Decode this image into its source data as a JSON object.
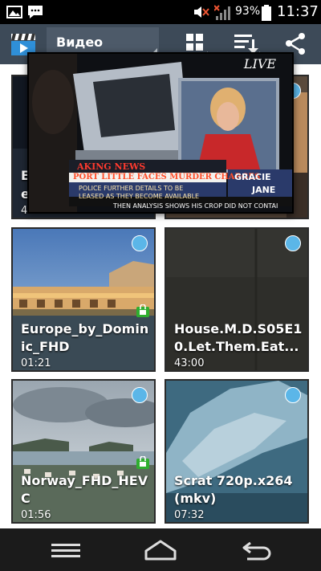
{
  "status_bar": {
    "icons_left": [
      "image-icon",
      "message-icon"
    ],
    "icons_right": [
      "mute-icon",
      "signal-icon",
      "battery-icon"
    ],
    "battery_percent": "93%",
    "time": "11:37"
  },
  "action_bar": {
    "title": "Видео",
    "buttons": [
      "grid-view-icon",
      "sort-icon",
      "share-icon"
    ]
  },
  "popup": {
    "live_label": "LIVE",
    "ticker_headline": "AKING NEWS",
    "ticker_line2": "PORT LITTLE FACES MURDER CHARGES",
    "ticker_line3a": "POLICE FURTHER DETAILS TO BE",
    "ticker_line3b": "LEASED AS THEY BECOME AVAILABLE",
    "ticker_crawl": "THEN ANALYSIS SHOWS HIS CROP DID NOT CONTAI",
    "name_tag_first": "GRACIE",
    "name_tag_second": "JANE"
  },
  "hidden_tile": {
    "char1": "E",
    "char2": "e",
    "char3": "4"
  },
  "videos": [
    {
      "name": "Europe_by_Dominic_FHD",
      "name_l1": "Europe_by_Domin",
      "name_l2": "ic_FHD",
      "duration": "01:21",
      "locked": true
    },
    {
      "name": "House.M.D.S05E10.Let.Them.Eat...",
      "name_l1": "House.M.D.S05E1",
      "name_l2": "0.Let.Them.Eat...",
      "duration": "43:00",
      "locked": false
    },
    {
      "name": "Norway_FHD_HEVC",
      "name_l1": "Norway_FHD_HEV",
      "name_l2": "C",
      "duration": "01:56",
      "locked": true
    },
    {
      "name": "Scrat 720p.x264 (mkv)",
      "name_l1": "Scrat 720p.x264",
      "name_l2": "(mkv)",
      "duration": "07:32",
      "locked": false
    }
  ],
  "colors": {
    "action_bar": "#3d4a58",
    "selection_dot": "#5bb6e8",
    "lock_badge": "#2fae2f"
  },
  "nav_bar": {
    "buttons": [
      "menu-icon",
      "home-icon",
      "back-icon"
    ]
  }
}
